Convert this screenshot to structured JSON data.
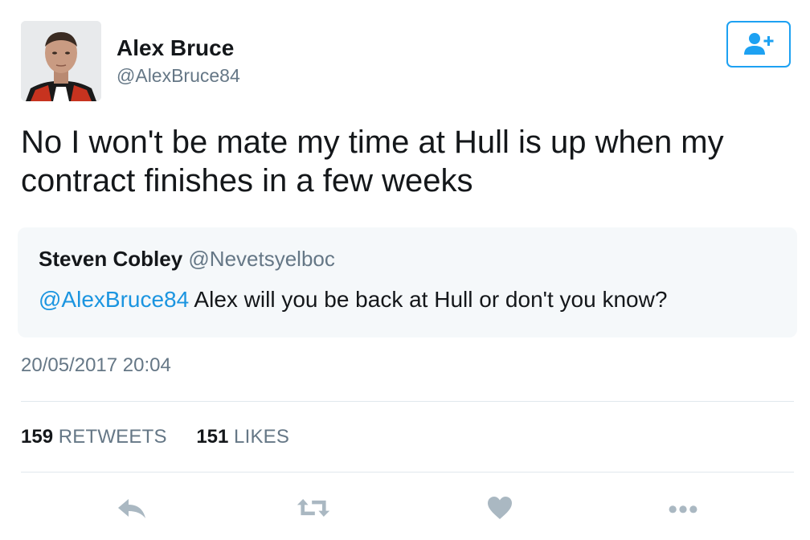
{
  "author": {
    "display_name": "Alex Bruce",
    "handle": "@AlexBruce84"
  },
  "follow_button": {
    "icon": "add-user-icon"
  },
  "tweet": {
    "text_line_1": "No I won't be mate my time at Hull is up when my",
    "text_line_2": "contract finishes in a few weeks",
    "timestamp": "20/05/2017 20:04"
  },
  "quoted_tweet": {
    "author_name": "Steven Cobley",
    "author_handle": "@Nevetsyelboc",
    "mention": "@AlexBruce84",
    "text": " Alex will you be back at Hull or don't you know?"
  },
  "stats": {
    "retweets_count": "159",
    "retweets_label": "RETWEETS",
    "likes_count": "151",
    "likes_label": "LIKES"
  },
  "actions": [
    "reply-icon",
    "retweet-icon",
    "like-icon",
    "more-icon"
  ],
  "colors": {
    "accent": "#1da1f2",
    "mention": "#1b95e0",
    "secondary_text": "#657786",
    "icon_gray": "#aab8c2",
    "quote_background": "#f5f8fa"
  }
}
